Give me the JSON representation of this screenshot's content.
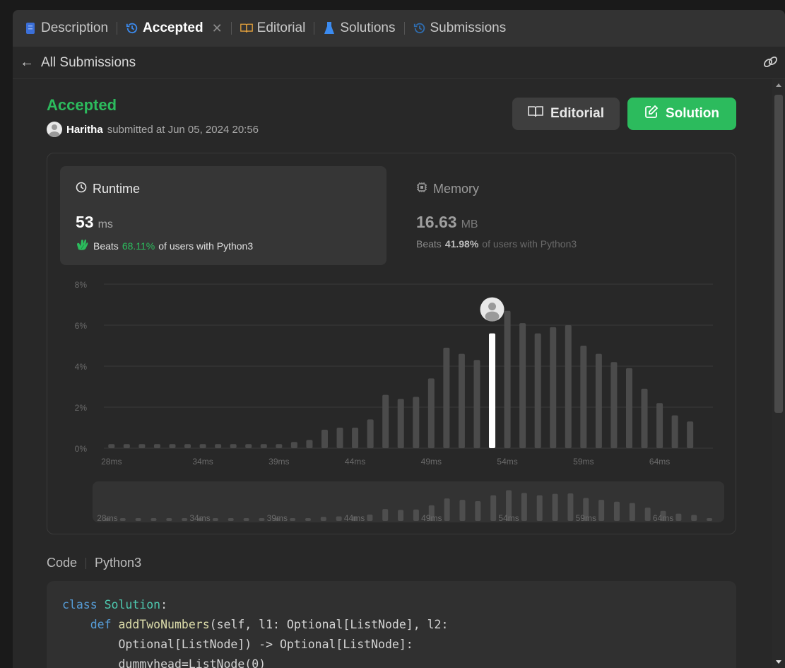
{
  "tabs": [
    {
      "label": "Description",
      "icon": "document-icon",
      "active": false
    },
    {
      "label": "Accepted",
      "icon": "history-icon",
      "active": true,
      "closable": true
    },
    {
      "label": "Editorial",
      "icon": "book-icon",
      "active": false
    },
    {
      "label": "Solutions",
      "icon": "flask-icon",
      "active": false
    },
    {
      "label": "Submissions",
      "icon": "history-icon",
      "active": false
    }
  ],
  "subbar": {
    "back_label": "All Submissions"
  },
  "submission": {
    "status": "Accepted",
    "user": "Haritha",
    "submitted_text": "submitted at Jun 05, 2024 20:56"
  },
  "buttons": {
    "editorial": "Editorial",
    "solution": "Solution"
  },
  "runtime": {
    "label": "Runtime",
    "value": "53",
    "unit": "ms",
    "beats_prefix": "Beats",
    "beats_pct": "68.11%",
    "beats_suffix": "of users with Python3"
  },
  "memory": {
    "label": "Memory",
    "value": "16.63",
    "unit": "MB",
    "beats_prefix": "Beats",
    "beats_pct": "41.98%",
    "beats_suffix": "of users with Python3"
  },
  "colors": {
    "accent_green": "#2cbb5d",
    "bar": "#4b4b4b",
    "highlight_bar": "#ffffff"
  },
  "chart_data": {
    "type": "bar",
    "x": [
      28,
      29,
      30,
      31,
      32,
      33,
      34,
      35,
      36,
      37,
      38,
      39,
      40,
      41,
      42,
      43,
      44,
      45,
      46,
      47,
      48,
      49,
      50,
      51,
      52,
      53,
      54,
      55,
      56,
      57,
      58,
      59,
      60,
      61,
      62,
      63,
      64,
      65,
      66,
      67
    ],
    "x_unit": "ms",
    "values": [
      0.2,
      0.2,
      0.2,
      0.2,
      0.2,
      0.2,
      0.2,
      0.2,
      0.2,
      0.2,
      0.2,
      0.2,
      0.3,
      0.4,
      0.9,
      1.0,
      1.0,
      1.4,
      2.6,
      2.4,
      2.5,
      3.4,
      4.9,
      4.6,
      4.3,
      5.6,
      6.7,
      6.1,
      5.6,
      5.9,
      6.0,
      5.0,
      4.6,
      4.2,
      3.9,
      2.9,
      2.2,
      1.6,
      1.3,
      0.0
    ],
    "highlight_x": 53,
    "x_ticks": [
      "28ms",
      "34ms",
      "39ms",
      "44ms",
      "49ms",
      "54ms",
      "59ms",
      "64ms"
    ],
    "y_ticks": [
      "0%",
      "2%",
      "4%",
      "6%",
      "8%"
    ],
    "ylim": [
      0,
      8
    ],
    "grid": true,
    "overview": true
  },
  "code": {
    "label": "Code",
    "language": "Python3",
    "line1_kw": "class",
    "line1_name": "Solution",
    "line1_end": ":",
    "line2_kw": "def",
    "line2_name": "addTwoNumbers",
    "line2_rest": "(self, l1: Optional[ListNode], l2:",
    "line3": "Optional[ListNode]) -> Optional[ListNode]:",
    "line4": "dummyhead=ListNode(0)"
  }
}
